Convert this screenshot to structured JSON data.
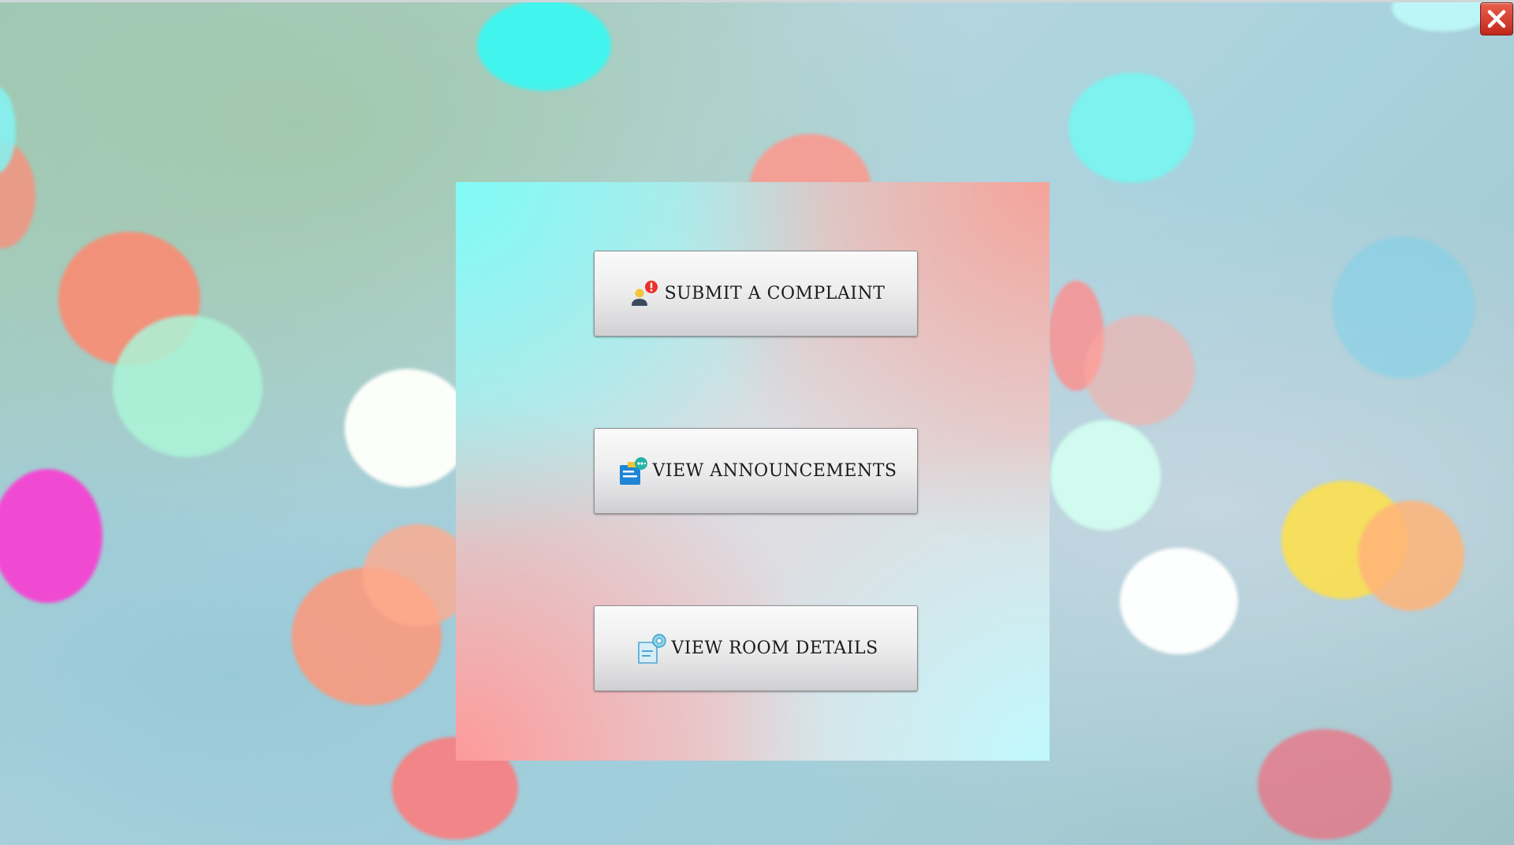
{
  "window": {
    "close_icon": "close-x-icon",
    "accent_close_color": "#d33a2c"
  },
  "menu": {
    "buttons": [
      {
        "label": "SUBMIT A COMPLAINT",
        "icon": "user-alert-icon"
      },
      {
        "label": "VIEW ANNOUNCEMENTS",
        "icon": "announcement-board-icon"
      },
      {
        "label": "VIEW ROOM DETAILS",
        "icon": "room-details-document-icon"
      }
    ]
  },
  "colors": {
    "panel_cyan": "#7ffcf6",
    "panel_pink": "#ff9a9a",
    "button_face": "#e6e6e8"
  }
}
